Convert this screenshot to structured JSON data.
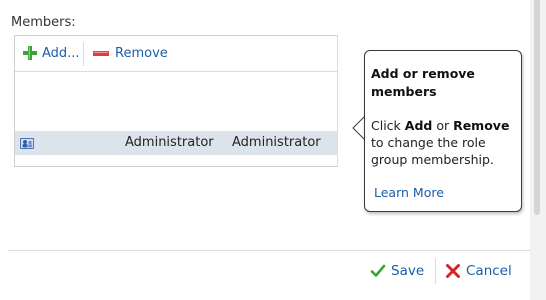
{
  "members": {
    "label": "Members:",
    "toolbar": {
      "add_label": "Add...",
      "remove_label": "Remove"
    },
    "rows": [
      {
        "name": "Administrator",
        "display_name": "Administrator",
        "icon": "user-group-icon"
      }
    ]
  },
  "callout": {
    "title": "Add or remove members",
    "body_prefix": "Click ",
    "body_add": "Add",
    "body_or": " or ",
    "body_remove": "Remove",
    "body_suffix": " to change the role group membership.",
    "learn_more": "Learn More"
  },
  "footer": {
    "save_label": "Save",
    "cancel_label": "Cancel"
  },
  "colors": {
    "link": "#1a5ea8",
    "selected_row": "#dde3ea",
    "add_icon": "#3aa335",
    "remove_icon": "#e0393e"
  }
}
